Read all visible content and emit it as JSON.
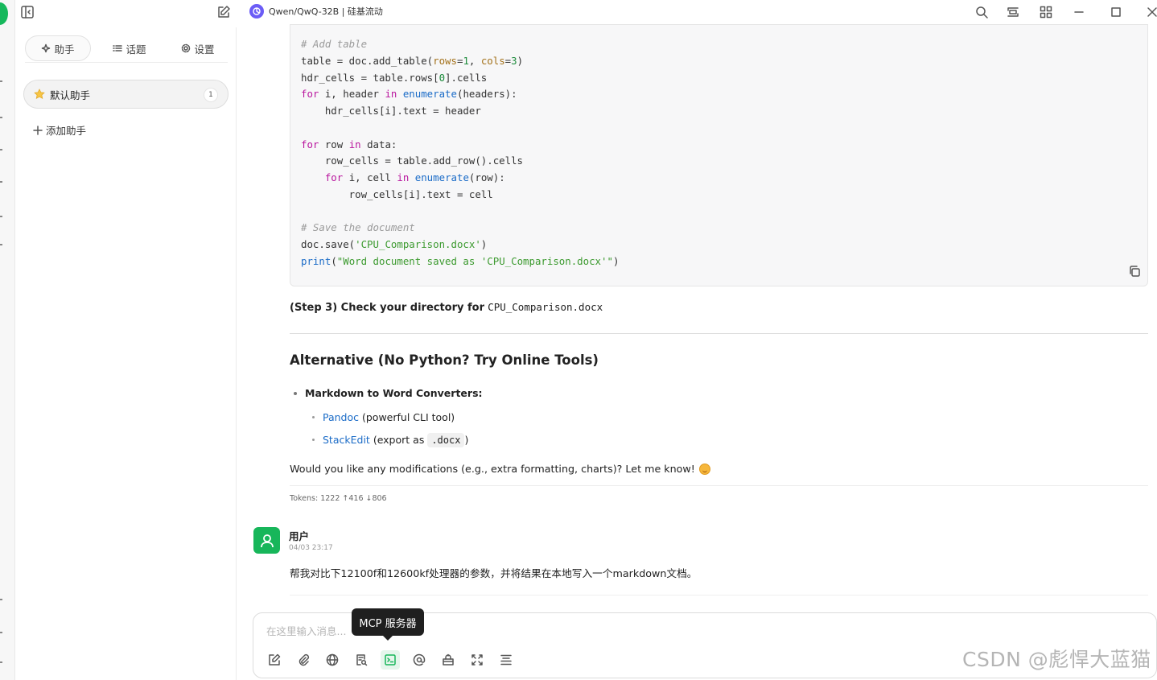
{
  "window": {
    "model_label": "Qwen/QwQ-32B | 硅基流动"
  },
  "panel": {
    "tabs": [
      {
        "label": "助手",
        "active": true,
        "icon": "sparkle-icon"
      },
      {
        "label": "话题",
        "active": false,
        "icon": "list-icon"
      },
      {
        "label": "设置",
        "active": false,
        "icon": "gear-icon"
      }
    ],
    "assistant": {
      "label": "默认助手",
      "icon": "star-icon",
      "count": "1"
    },
    "add_assistant_label": "添加助手"
  },
  "code": {
    "lines": [
      [
        {
          "t": "# Add table",
          "c": "cmt"
        }
      ],
      [
        {
          "t": "table = doc.add_table("
        },
        {
          "t": "rows",
          "c": "arg"
        },
        {
          "t": "="
        },
        {
          "t": "1",
          "c": "num"
        },
        {
          "t": ", "
        },
        {
          "t": "cols",
          "c": "arg"
        },
        {
          "t": "="
        },
        {
          "t": "3",
          "c": "num"
        },
        {
          "t": ")"
        }
      ],
      [
        {
          "t": "hdr_cells = table.rows["
        },
        {
          "t": "0",
          "c": "num"
        },
        {
          "t": "].cells"
        }
      ],
      [
        {
          "t": "for",
          "c": "kw"
        },
        {
          "t": " i, header "
        },
        {
          "t": "in",
          "c": "kw"
        },
        {
          "t": " "
        },
        {
          "t": "enumerate",
          "c": "fn"
        },
        {
          "t": "(headers):"
        }
      ],
      [
        {
          "t": "    hdr_cells[i].text = header"
        }
      ],
      [
        {
          "t": ""
        }
      ],
      [
        {
          "t": "for",
          "c": "kw"
        },
        {
          "t": " row "
        },
        {
          "t": "in",
          "c": "kw"
        },
        {
          "t": " data:"
        }
      ],
      [
        {
          "t": "    row_cells = table.add_row().cells"
        }
      ],
      [
        {
          "t": "    "
        },
        {
          "t": "for",
          "c": "kw"
        },
        {
          "t": " i, cell "
        },
        {
          "t": "in",
          "c": "kw"
        },
        {
          "t": " "
        },
        {
          "t": "enumerate",
          "c": "fn"
        },
        {
          "t": "(row):"
        }
      ],
      [
        {
          "t": "        row_cells[i].text = cell"
        }
      ],
      [
        {
          "t": ""
        }
      ],
      [
        {
          "t": "# Save the document",
          "c": "cmt"
        }
      ],
      [
        {
          "t": "doc.save("
        },
        {
          "t": "'CPU_Comparison.docx'",
          "c": "str"
        },
        {
          "t": ")"
        }
      ],
      [
        {
          "t": "print",
          "c": "fn"
        },
        {
          "t": "("
        },
        {
          "t": "\"Word document saved as 'CPU_Comparison.docx'\"",
          "c": "str"
        },
        {
          "t": ")"
        }
      ]
    ]
  },
  "answer": {
    "step3_bold": "(Step 3) Check your directory for",
    "step3_file": "CPU_Comparison.docx",
    "alt_heading": "Alternative (No Python? Try Online Tools)",
    "bullet_title": "Markdown to Word Converters:",
    "sub_items": [
      {
        "link": "Pandoc",
        "rest": "(powerful CLI tool)"
      },
      {
        "link": "StackEdit",
        "rest": "(export as",
        "code": ".docx",
        "tail": ")"
      }
    ],
    "followup": "Would you like any modifications (e.g., extra formatting, charts)? Let me know!",
    "tokens": "Tokens: 1222 ↑416 ↓806"
  },
  "user_message": {
    "name": "用户",
    "time": "04/03 23:17",
    "text": "帮我对比下12100f和12600kf处理器的参数，并将结果在本地写入一个markdown文档。"
  },
  "input": {
    "placeholder": "在这里输入消息...",
    "tooltip": "MCP 服务器"
  },
  "watermark": "CSDN @彪悍大蓝猫",
  "colors": {
    "accent": "#17b65a",
    "link": "#1a6bc7",
    "model_logo": "#6b5cf6"
  }
}
